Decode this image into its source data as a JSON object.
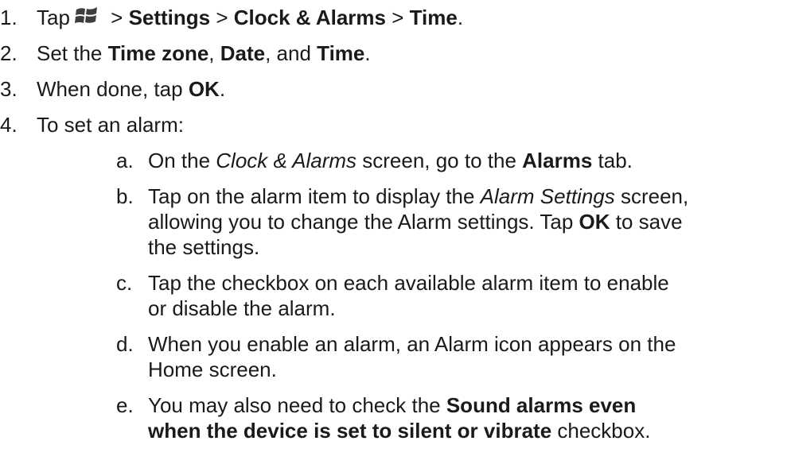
{
  "steps": [
    {
      "num": "1.",
      "tap": "Tap",
      "sep1": " > ",
      "settings": "Settings",
      "sep2": " > ",
      "clock_alarms": "Clock & Alarms",
      "sep3": " > ",
      "time": "Time",
      "end": "."
    },
    {
      "num": "2.",
      "pre": "Set the ",
      "time_zone": "Time zone",
      "comma1": ", ",
      "date": "Date",
      "and": ", and ",
      "time": "Time",
      "end": "."
    },
    {
      "num": "3.",
      "pre": "When done, tap ",
      "ok": "OK",
      "end": "."
    },
    {
      "num": "4.",
      "text": "To set an alarm:"
    }
  ],
  "substeps": {
    "a": {
      "num": "a.",
      "pre": "On the ",
      "screen": "Clock & Alarms",
      "mid": " screen, go to the ",
      "tab": "Alarms",
      "end": " tab."
    },
    "b": {
      "num": "b.",
      "pre": "Tap on the alarm item to display the ",
      "screen": "Alarm Settings",
      "end1": " screen,",
      "line2": "allowing you to change the Alarm settings. Tap ",
      "ok": "OK",
      "end2": " to save",
      "line3": "the settings."
    },
    "c": {
      "num": "c.",
      "line1": "Tap the checkbox on each available alarm item to enable",
      "line2": "or disable the alarm."
    },
    "d": {
      "num": "d.",
      "line1": "When you enable an alarm, an Alarm icon appears on the",
      "line2": "Home screen."
    },
    "e": {
      "num": "e.",
      "pre": "You may also need to check the ",
      "bold1": "Sound alarms even",
      "bold2": "when the device is set to silent or vibrate",
      "end": " checkbox."
    }
  },
  "icons": {
    "start": "windows-start-icon"
  }
}
